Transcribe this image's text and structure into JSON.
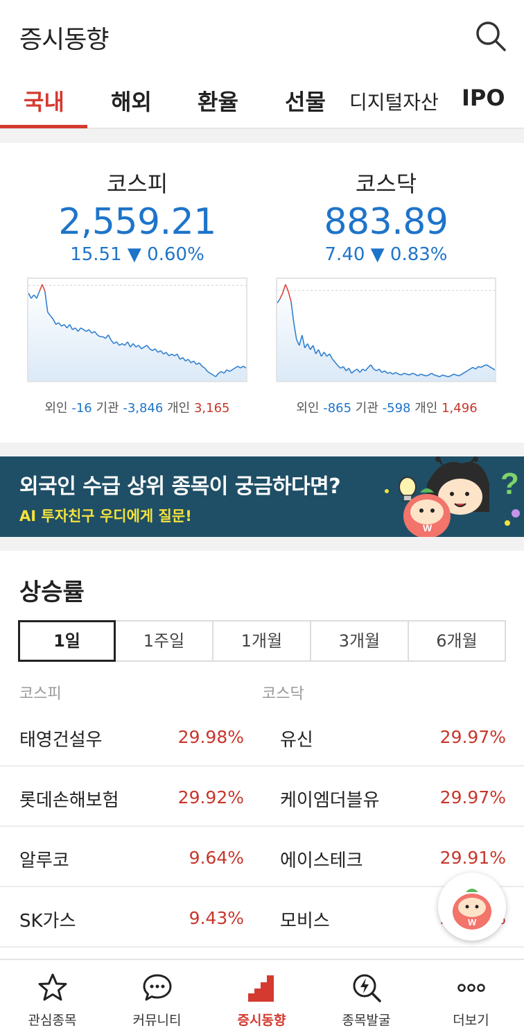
{
  "header": {
    "title": "증시동향",
    "search_icon": "search-icon"
  },
  "tabs": [
    {
      "label": "국내",
      "active": true
    },
    {
      "label": "해외"
    },
    {
      "label": "환율"
    },
    {
      "label": "선물"
    },
    {
      "label": "디지털자산"
    },
    {
      "label": "IPO"
    }
  ],
  "indices": [
    {
      "name": "코스피",
      "value": "2,559.21",
      "change": "15.51",
      "direction": "▼",
      "percent": "0.60%",
      "investors": {
        "foreign_label": "외인",
        "foreign": "-16",
        "inst_label": "기관",
        "inst": "-3,846",
        "indiv_label": "개인",
        "indiv": "3,165"
      }
    },
    {
      "name": "코스닥",
      "value": "883.89",
      "change": "7.40",
      "direction": "▼",
      "percent": "0.83%",
      "investors": {
        "foreign_label": "외인",
        "foreign": "-865",
        "inst_label": "기관",
        "inst": "-598",
        "indiv_label": "개인",
        "indiv": "1,496"
      }
    }
  ],
  "banner": {
    "main": "외국인 수급 상위 종목이 궁금하다면?",
    "sub": "AI 투자친구 우디에게 질문!"
  },
  "rise_rate": {
    "title": "상승률",
    "periods": [
      {
        "label": "1일",
        "active": true
      },
      {
        "label": "1주일"
      },
      {
        "label": "1개월"
      },
      {
        "label": "3개월"
      },
      {
        "label": "6개월"
      }
    ],
    "kospi_label": "코스피",
    "kosdaq_label": "코스닥",
    "kospi": [
      {
        "name": "태영건설우",
        "pct": "29.98%"
      },
      {
        "name": "롯데손해보험",
        "pct": "29.92%"
      },
      {
        "name": "알루코",
        "pct": "9.64%"
      },
      {
        "name": "SK가스",
        "pct": "9.43%"
      }
    ],
    "kosdaq": [
      {
        "name": "유신",
        "pct": "29.97%"
      },
      {
        "name": "케이엠더블유",
        "pct": "29.97%"
      },
      {
        "name": "에이스테크",
        "pct": "29.91%"
      },
      {
        "name": "모비스",
        "pct": "29.57%"
      }
    ]
  },
  "bottom_nav": [
    {
      "label": "관심종목",
      "icon": "star-icon"
    },
    {
      "label": "커뮤니티",
      "icon": "chat-bubble-icon"
    },
    {
      "label": "증시동향",
      "icon": "bar-chart-icon",
      "active": true
    },
    {
      "label": "종목발굴",
      "icon": "lightning-search-icon"
    },
    {
      "label": "더보기",
      "icon": "more-dots-icon"
    }
  ],
  "colors": {
    "accent": "#d43a2f",
    "down_blue": "#1e74c9",
    "banner_bg": "#1f4f66",
    "banner_sub": "#f5e23b"
  },
  "chart_data": [
    {
      "type": "line",
      "x": [
        0,
        1,
        2,
        3,
        4,
        5,
        6,
        7,
        8,
        9,
        10,
        11,
        12,
        13,
        14,
        15,
        16,
        17,
        18,
        19,
        20,
        21,
        22,
        23,
        24,
        25,
        26,
        27,
        28,
        29,
        30,
        31,
        32,
        33,
        34,
        35,
        36,
        37,
        38,
        39,
        40,
        41,
        42,
        43,
        44,
        45,
        46,
        47,
        48,
        49,
        50,
        51,
        52,
        53,
        54,
        55,
        56,
        57,
        58,
        59,
        60,
        61,
        62,
        63,
        64,
        65,
        66,
        67,
        68,
        69,
        70,
        71,
        72,
        73,
        74,
        75,
        76,
        77,
        78,
        79
      ],
      "series": [
        {
          "values": [
            2572.5,
            2571.0,
            2572.0,
            2571.0,
            2573.0,
            2575.0,
            2573.0,
            2567.0,
            2566.0,
            2565.0,
            2563.5,
            2564.0,
            2563.0,
            2563.5,
            2562.5,
            2563.5,
            2562.0,
            2562.5,
            2561.5,
            2562.5,
            2562.0,
            2561.5,
            2562.0,
            2561.0,
            2561.5,
            2560.5,
            2560.0,
            2560.0,
            2559.5,
            2560.5,
            2559.0,
            2558.0,
            2558.5,
            2557.5,
            2558.0,
            2557.5,
            2558.5,
            2557.0,
            2558.0,
            2557.0,
            2557.5,
            2556.5,
            2557.0,
            2557.5,
            2556.5,
            2556.0,
            2556.5,
            2555.5,
            2556.0,
            2555.0,
            2555.5,
            2554.5,
            2555.0,
            2554.5,
            2555.0,
            2553.5,
            2554.0,
            2553.0,
            2553.5,
            2552.5,
            2553.0,
            2552.0,
            2552.5,
            2551.5,
            2551.0,
            2550.0,
            2549.5,
            2549.0,
            2548.5,
            2549.5,
            2550.0,
            2549.5,
            2550.5,
            2550.0,
            2550.5,
            2551.0,
            2551.5,
            2551.0,
            2551.5,
            2551.0
          ]
        }
      ],
      "baseline": 2574.72
    },
    {
      "type": "line",
      "x": [
        0,
        1,
        2,
        3,
        4,
        5,
        6,
        7,
        8,
        9,
        10,
        11,
        12,
        13,
        14,
        15,
        16,
        17,
        18,
        19,
        20,
        21,
        22,
        23,
        24,
        25,
        26,
        27,
        28,
        29,
        30,
        31,
        32,
        33,
        34,
        35,
        36,
        37,
        38,
        39,
        40,
        41,
        42,
        43,
        44,
        45,
        46,
        47,
        48,
        49,
        50,
        51,
        52,
        53,
        54,
        55,
        56,
        57,
        58,
        59,
        60,
        61,
        62,
        63,
        64,
        65,
        66,
        67,
        68,
        69,
        70,
        71,
        72,
        73,
        74,
        75,
        76,
        77,
        78,
        79
      ],
      "series": [
        {
          "values": [
            889.8,
            890.3,
            891.0,
            892.0,
            891.2,
            890.0,
            887.5,
            885.5,
            884.8,
            886.0,
            884.5,
            885.0,
            884.3,
            884.8,
            883.8,
            884.3,
            883.5,
            884.0,
            883.5,
            883.8,
            883.2,
            882.8,
            882.4,
            882.1,
            882.3,
            881.8,
            882.1,
            881.5,
            881.8,
            882.0,
            881.6,
            882.0,
            881.8,
            882.2,
            882.5,
            882.0,
            881.8,
            882.0,
            881.6,
            881.8,
            881.5,
            881.6,
            881.4,
            881.6,
            881.4,
            881.3,
            881.5,
            881.4,
            881.3,
            881.5,
            881.4,
            881.2,
            881.4,
            881.3,
            881.2,
            881.3,
            881.5,
            881.3,
            881.2,
            881.1,
            881.3,
            881.2,
            881.1,
            881.2,
            881.4,
            881.3,
            881.2,
            881.4,
            881.6,
            881.8,
            882.0,
            882.2,
            882.0,
            882.3,
            882.2,
            882.4,
            882.5,
            882.3,
            882.1,
            881.9
          ]
        }
      ],
      "baseline": 891.29
    }
  ]
}
